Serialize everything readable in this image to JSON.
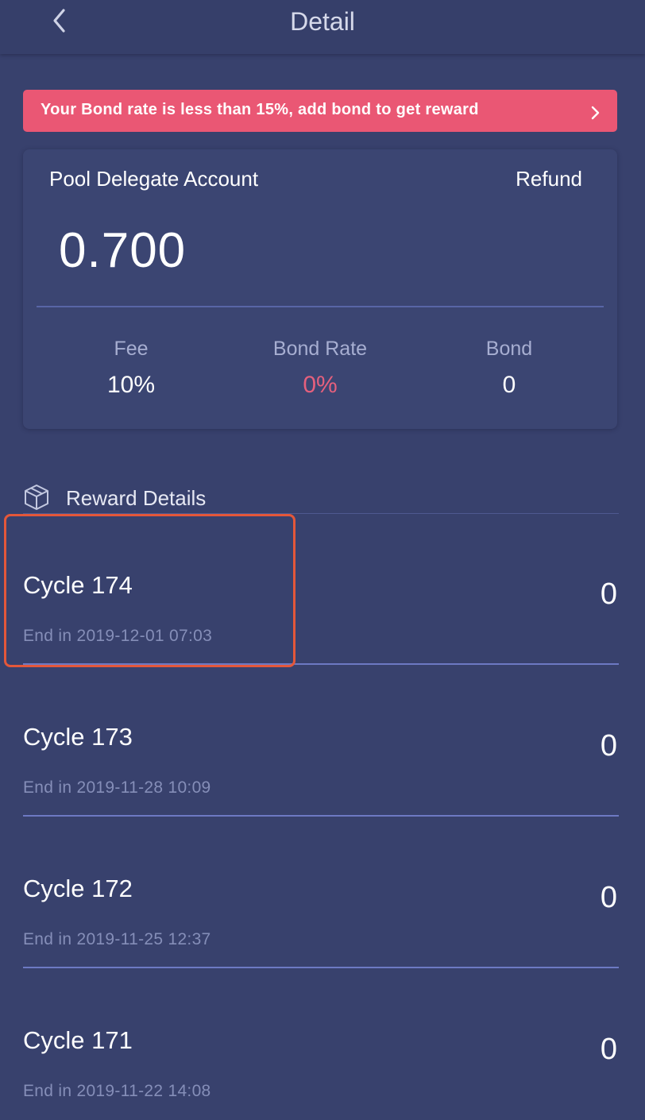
{
  "header": {
    "title": "Detail",
    "back_icon": "chevron-left-icon"
  },
  "alert": {
    "text": "Your Bond rate is less than 15%, add bond to get reward",
    "icon": "chevron-right-icon",
    "color": "#ea5774"
  },
  "account": {
    "title": "Pool Delegate Account",
    "refund_label": "Refund",
    "balance": "0.700",
    "stats": [
      {
        "label": "Fee",
        "value": "10%"
      },
      {
        "label": "Bond Rate",
        "value": "0%",
        "color": "#e5607d"
      },
      {
        "label": "Bond",
        "value": "0"
      }
    ]
  },
  "rewards": {
    "title": "Reward Details",
    "icon": "cube-icon",
    "cycles": [
      {
        "title": "Cycle 174",
        "end": "End in 2019-12-01 07:03",
        "amount": "0"
      },
      {
        "title": "Cycle 173",
        "end": "End in 2019-11-28 10:09",
        "amount": "0"
      },
      {
        "title": "Cycle 172",
        "end": "End in 2019-11-25 12:37",
        "amount": "0"
      },
      {
        "title": "Cycle 171",
        "end": "End in 2019-11-22 14:08",
        "amount": "0"
      }
    ]
  },
  "annotation": {
    "highlight_color": "#e4573a"
  }
}
